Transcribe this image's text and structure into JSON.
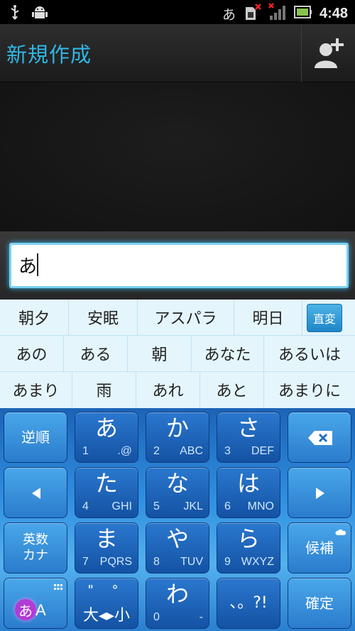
{
  "status_bar": {
    "ime_indicator": "あ",
    "time": "4:48",
    "icons": [
      "usb-icon",
      "android-debug-icon",
      "sim-error-icon",
      "signal-no-service-icon",
      "battery-icon"
    ]
  },
  "action_bar": {
    "title": "新規作成",
    "add_contact_icon": "add-contact-icon"
  },
  "compose": {
    "text": "あ"
  },
  "candidates": {
    "row1": [
      "朝夕",
      "安眠",
      "アスパラ",
      "明日"
    ],
    "convert_label": "直変",
    "row2": [
      "あの",
      "ある",
      "朝",
      "あなた",
      "あるいは"
    ],
    "row3": [
      "あまり",
      "雨",
      "あれ",
      "あと",
      "あまりに"
    ]
  },
  "keyboard": {
    "reverse": "逆順",
    "keys": [
      {
        "kana": "あ",
        "num": "1",
        "letters": ".@"
      },
      {
        "kana": "か",
        "num": "2",
        "letters": "ABC"
      },
      {
        "kana": "さ",
        "num": "3",
        "letters": "DEF"
      },
      {
        "kana": "た",
        "num": "4",
        "letters": "GHI"
      },
      {
        "kana": "な",
        "num": "5",
        "letters": "JKL"
      },
      {
        "kana": "は",
        "num": "6",
        "letters": "MNO"
      },
      {
        "kana": "ま",
        "num": "7",
        "letters": "PQRS"
      },
      {
        "kana": "や",
        "num": "8",
        "letters": "TUV"
      },
      {
        "kana": "ら",
        "num": "9",
        "letters": "WXYZ"
      },
      {
        "kana": "わ",
        "num": "0",
        "letters": "-"
      }
    ],
    "eisu_kana_line1": "英数",
    "eisu_kana_line2": "カナ",
    "candidates_key": "候補",
    "mode_kana": "あ",
    "mode_alpha": "A",
    "dakuten_top": "\" °",
    "size_toggle": "大◂▸小",
    "punct": "、。?!",
    "confirm": "確定",
    "colors": {
      "accent": "#33b5e5",
      "key_blue": "#1f6fc6"
    }
  }
}
